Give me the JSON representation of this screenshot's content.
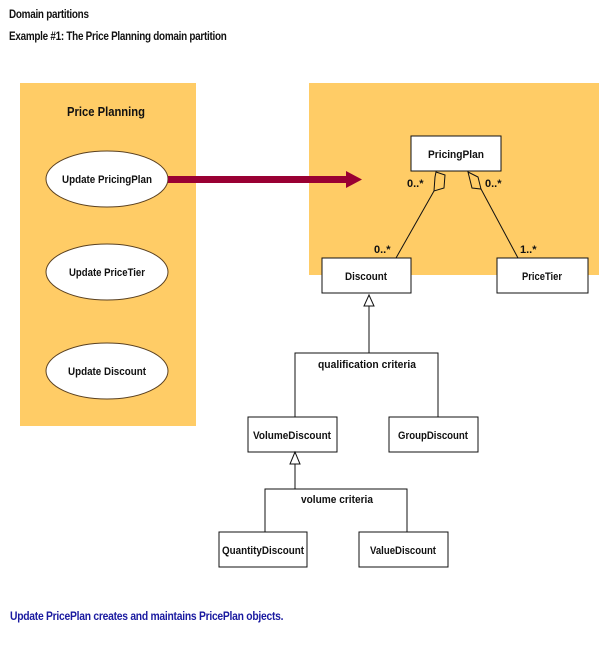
{
  "header": {
    "section_title": "Domain partitions",
    "example_title": "Example #1: The Price Planning domain partition"
  },
  "colors": {
    "partition_fill": "#ffcc66",
    "arrow": "#990033",
    "caption": "#1a1aa0",
    "line": "#111111"
  },
  "use_case_partition": {
    "title": "Price Planning",
    "use_cases": [
      {
        "label": "Update PricingPlan"
      },
      {
        "label": "Update  PriceTier"
      },
      {
        "label": "Update Discount"
      }
    ]
  },
  "class_model": {
    "classes": {
      "pricing_plan": "PricingPlan",
      "discount": "Discount",
      "price_tier": "PriceTier",
      "volume_discount": "VolumeDiscount",
      "group_discount": "GroupDiscount",
      "quantity_discount": "QuantityDiscount",
      "value_discount": "ValueDiscount"
    },
    "multiplicities": {
      "plan_to_discount_plan_end": "0..*",
      "plan_to_discount_discount_end": "0..*",
      "plan_to_tier_plan_end": "0..*",
      "plan_to_tier_tier_end": "1..*"
    },
    "discriminators": {
      "discount": "qualification criteria",
      "volume_discount": "volume criteria"
    }
  },
  "caption": "Update PricePlan creates and maintains PricePlan objects."
}
